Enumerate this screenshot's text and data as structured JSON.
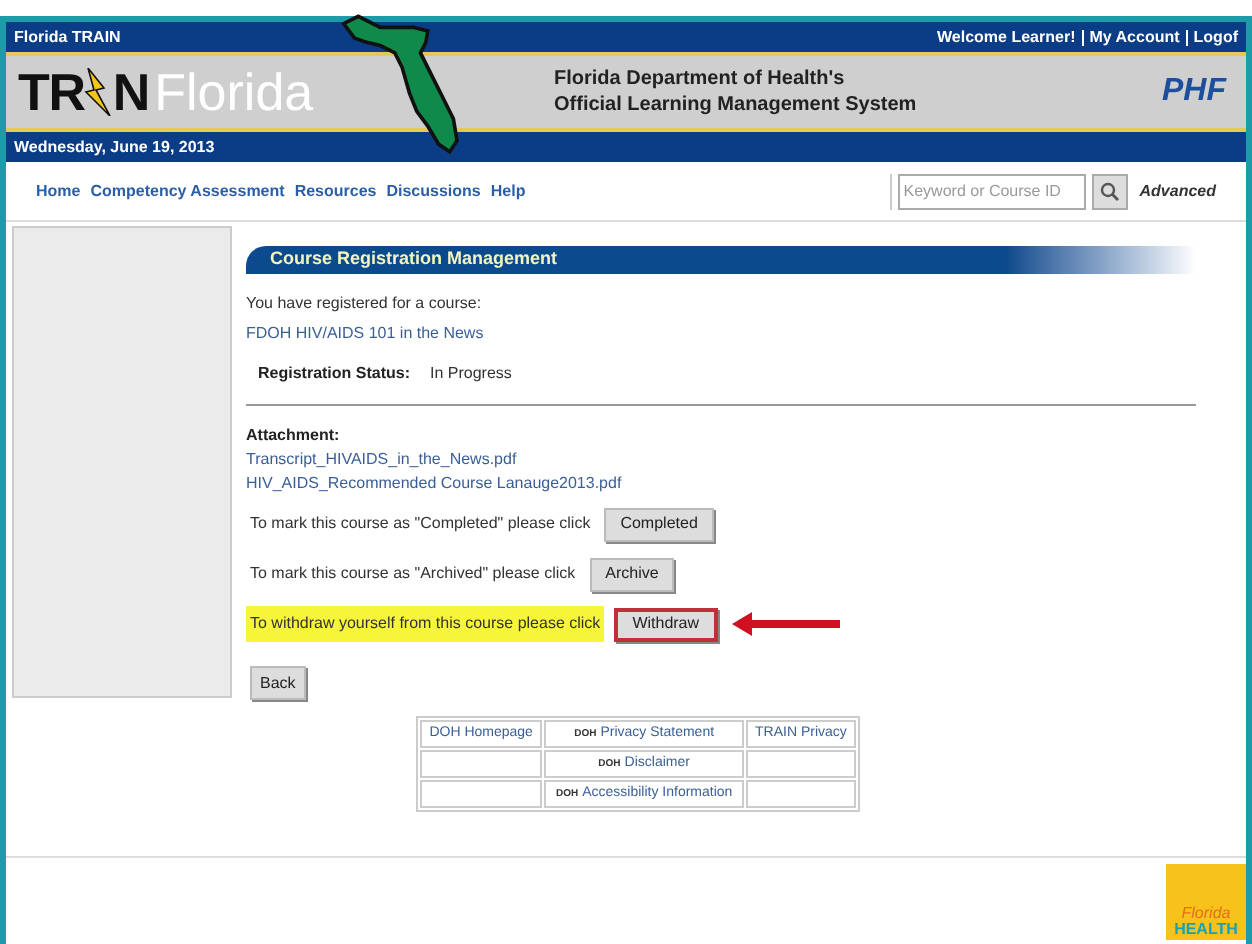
{
  "top_bar": {
    "site_name": "Florida TRAIN",
    "welcome": "Welcome Learner!",
    "links": [
      "My Account",
      "Logof"
    ]
  },
  "banner": {
    "logo_left": "TR",
    "logo_right": "N",
    "logo_state": "Florida",
    "title_lines": [
      "Florida Department of Health's",
      "Official Learning Management System"
    ],
    "partner_logo": "PHF"
  },
  "date_bar": {
    "date": "Wednesday, June 19, 2013"
  },
  "nav": {
    "items": [
      "Home",
      "Competency Assessment",
      "Resources",
      "Discussions",
      "Help"
    ],
    "search": {
      "placeholder": "Keyword or Course ID"
    },
    "advanced": "Advanced"
  },
  "content": {
    "section_title": "Course Registration Management",
    "intro": "You have registered for a course:",
    "course_link": "FDOH HIV/AIDS 101 in the News",
    "status_label": "Registration Status:",
    "status_value": "In Progress",
    "attachment_label": "Attachment:",
    "attachments": [
      "Transcript_HIVAIDS_in_the_News.pdf",
      "HIV_AIDS_Recommended Course Lanauge2013.pdf"
    ],
    "actions": [
      {
        "text": "To mark this course as \"Completed\" please click",
        "button": "Completed",
        "highlighted": false
      },
      {
        "text": "To mark this course as \"Archived\" please click",
        "button": "Archive",
        "highlighted": false
      },
      {
        "text": "To withdraw yourself from this course please click",
        "button": "Withdraw",
        "highlighted": true
      }
    ],
    "back_button": "Back"
  },
  "footer_links": [
    {
      "column_1": {
        "text": "DOH Homepage"
      },
      "column_2": {
        "prefix": "DOH",
        "text": "Privacy Statement"
      },
      "column_3": {
        "text": "TRAIN Privacy"
      }
    },
    {
      "column_2": {
        "prefix": "DOH",
        "text": "Disclaimer"
      }
    },
    {
      "column_2": {
        "prefix": "DOH",
        "text": "Accessibility Information"
      }
    }
  ],
  "corner_logo": {
    "lines": [
      "Florida",
      "HEALTH"
    ]
  }
}
